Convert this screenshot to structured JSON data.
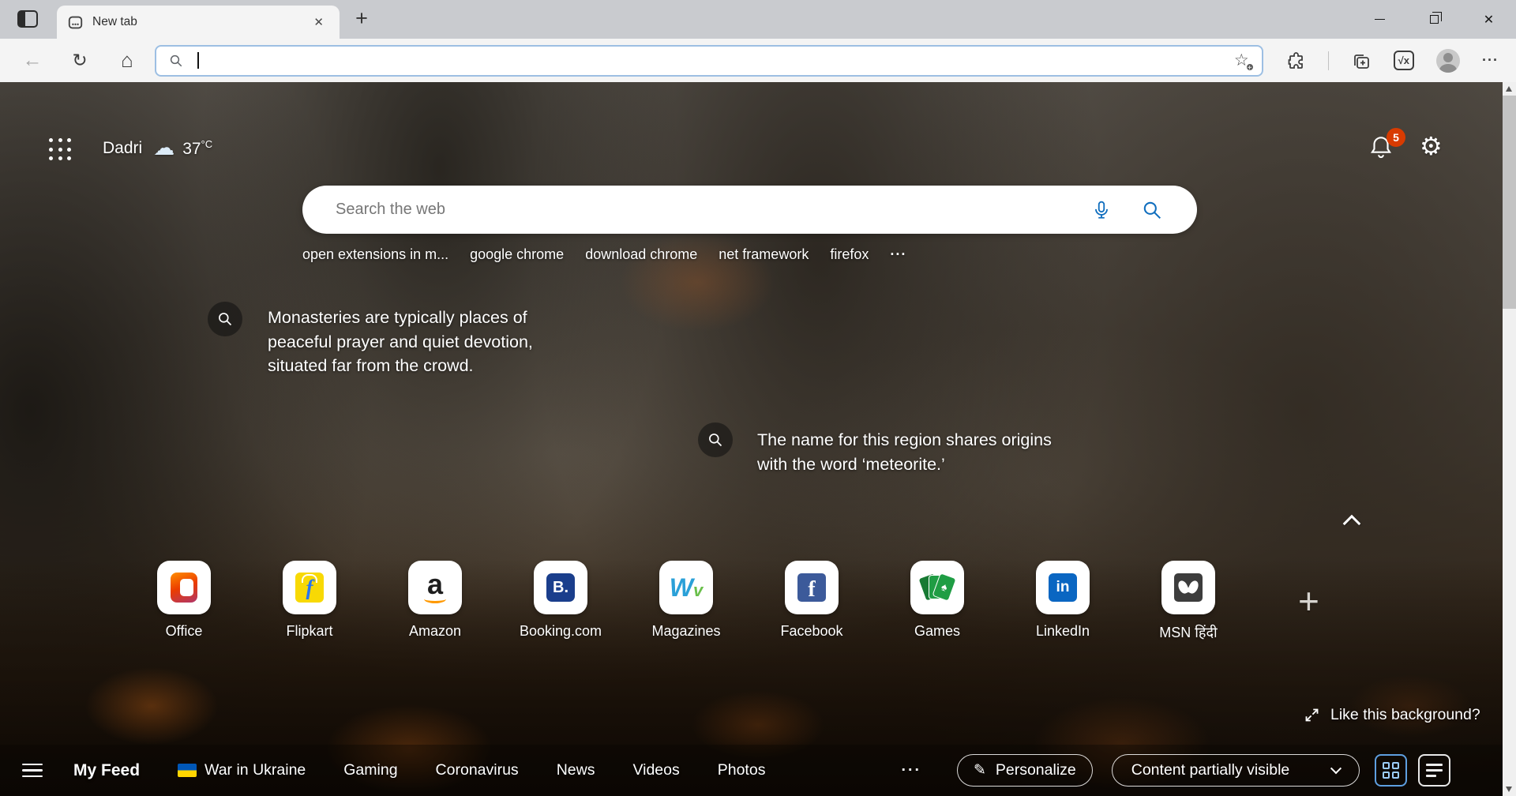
{
  "browser": {
    "tab_title": "New tab",
    "address_value": "",
    "icons": {
      "back": "←",
      "refresh": "↻",
      "home": "⌂",
      "star": "☆",
      "star_plus": "+",
      "math_solver": "√x",
      "more_dots": "···",
      "new_tab_plus": "+",
      "close_tab": "✕",
      "window_close": "✕",
      "gear": "⚙",
      "cloud": "☁",
      "pencil": "✎",
      "spade": "♠"
    }
  },
  "newtab": {
    "weather": {
      "location": "Dadri",
      "temp_value": "37",
      "temp_unit": "°C"
    },
    "notification_count": "5",
    "search_placeholder": "Search the web",
    "suggestions": [
      "open extensions in m...",
      "google chrome",
      "download chrome",
      "net framework",
      "firefox",
      "···"
    ],
    "cards": [
      {
        "lines": [
          "Monasteries are typically places of",
          "peaceful prayer and quiet devotion,",
          "situated far from the crowd."
        ]
      },
      {
        "lines": [
          "The name for this region shares origins",
          "with the word ‘meteorite.’"
        ]
      }
    ],
    "quick_links": [
      {
        "label": "Office"
      },
      {
        "label": "Flipkart"
      },
      {
        "label": "Amazon"
      },
      {
        "label": "Booking.com"
      },
      {
        "label": "Magazines"
      },
      {
        "label": "Facebook"
      },
      {
        "label": "Games"
      },
      {
        "label": "LinkedIn"
      },
      {
        "label": "MSN हिंदी"
      }
    ],
    "add_site": "+",
    "background_prompt": "Like this background?"
  },
  "feed": {
    "items": [
      "My Feed",
      "War in Ukraine",
      "Gaming",
      "Coronavirus",
      "News",
      "Videos",
      "Photos"
    ],
    "more": "···",
    "personalize": "Personalize",
    "visibility": "Content partially visible",
    "magazines_glyphs": {
      "w": "W"
    }
  },
  "colors": {
    "accent_blue": "#106ebe",
    "badge_red": "#d83b01",
    "ukraine_blue": "#0057b7",
    "ukraine_yellow": "#ffd500"
  }
}
